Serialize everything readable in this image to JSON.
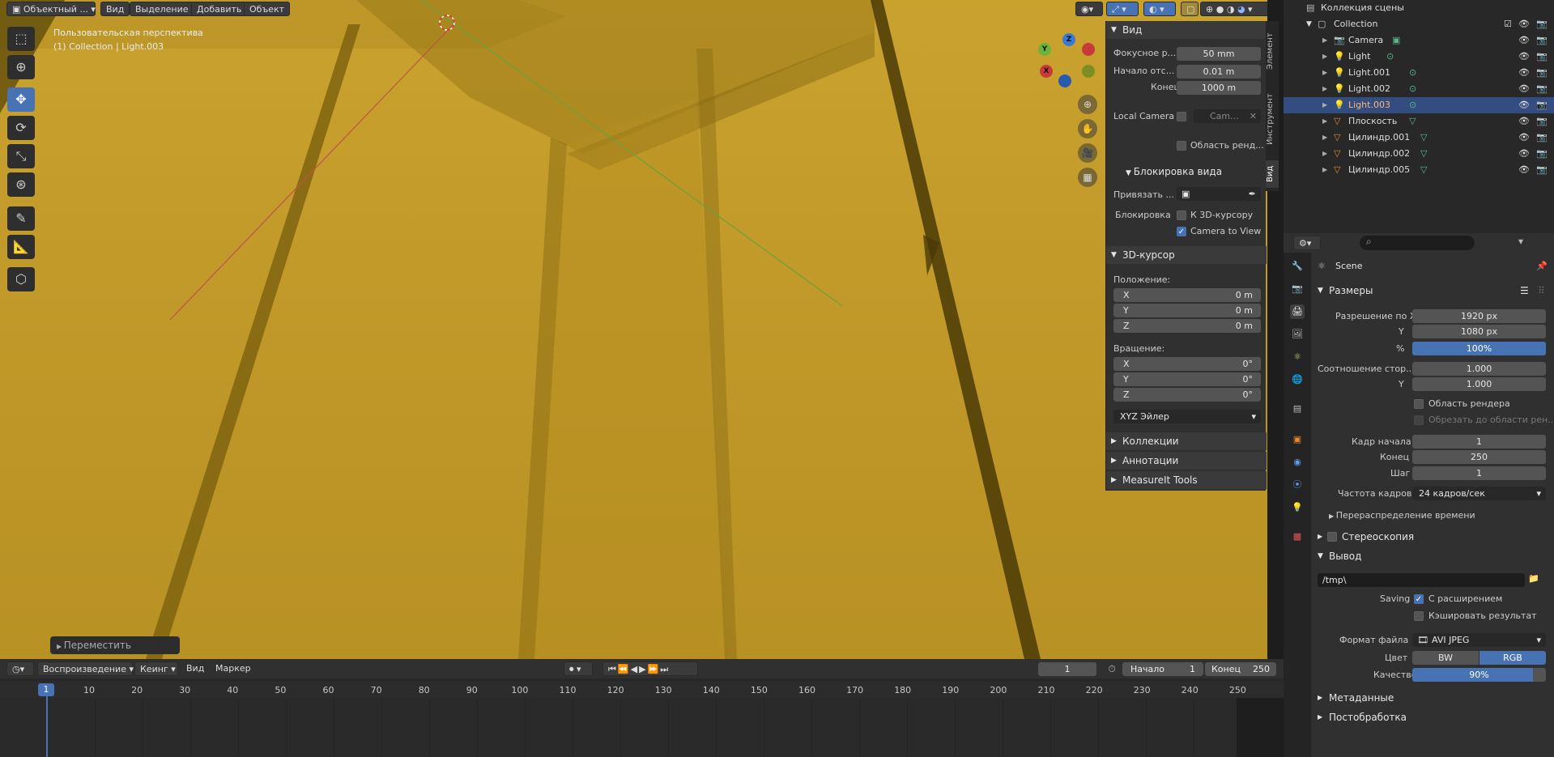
{
  "header": {
    "mode": "Объектный ...",
    "menu": [
      "Вид",
      "Выделение",
      "Добавить",
      "Объект"
    ]
  },
  "viewport_info": {
    "perspective": "Пользовательская перспектива",
    "collection": "(1) Collection | Light.003"
  },
  "gizmo": {
    "x": "X",
    "y": "Y",
    "z": "Z"
  },
  "npanel": {
    "tabs": [
      "Элемент",
      "Инструмент",
      "Вид"
    ],
    "view": {
      "header": "Вид",
      "focal_label": "Фокусное р...",
      "focal_value": "50 mm",
      "clip_start_label": "Начало отс...",
      "clip_start_value": "0.01 m",
      "clip_end_label": "Конец",
      "clip_end_value": "1000 m",
      "local_camera_label": "Local Camera",
      "camera_field": "Cam...",
      "render_region_label": "Область ренд...",
      "lock_header": "Блокировка вида",
      "lock_to_label": "Привязать ...",
      "lock_label": "Блокировка",
      "lock_cursor_label": "К 3D-курсору",
      "camera_to_view_label": "Camera to View"
    },
    "cursor": {
      "header": "3D-курсор",
      "location_label": "Положение:",
      "loc": [
        {
          "axis": "X",
          "value": "0 m"
        },
        {
          "axis": "Y",
          "value": "0 m"
        },
        {
          "axis": "Z",
          "value": "0 m"
        }
      ],
      "rotation_label": "Вращение:",
      "rot": [
        {
          "axis": "X",
          "value": "0°"
        },
        {
          "axis": "Y",
          "value": "0°"
        },
        {
          "axis": "Z",
          "value": "0°"
        }
      ],
      "rotation_mode": "XYZ Эйлер"
    },
    "collapsed": [
      "Коллекции",
      "Аннотации",
      "MeasureIt Tools"
    ]
  },
  "operator_panel": "Переместить",
  "timeline": {
    "menu": [
      "Воспроизведение",
      "Кеинг",
      "Вид",
      "Маркер"
    ],
    "current_frame": "1",
    "start_label": "Начало",
    "start_value": "1",
    "end_label": "Конец",
    "end_value": "250",
    "ruler_marker": "1",
    "ruler": [
      "10",
      "20",
      "30",
      "40",
      "50",
      "60",
      "70",
      "80",
      "90",
      "100",
      "110",
      "120",
      "130",
      "140",
      "150",
      "160",
      "170",
      "180",
      "190",
      "200",
      "210",
      "220",
      "230",
      "240",
      "250"
    ]
  },
  "outliner": {
    "header": "Коллекция сцены",
    "collection": "Collection",
    "items": [
      {
        "name": "Camera",
        "kind": "camera",
        "selected": false
      },
      {
        "name": "Light",
        "kind": "light",
        "selected": false
      },
      {
        "name": "Light.001",
        "kind": "light",
        "selected": false
      },
      {
        "name": "Light.002",
        "kind": "light",
        "selected": false
      },
      {
        "name": "Light.003",
        "kind": "light",
        "selected": true
      },
      {
        "name": "Плоскость",
        "kind": "mesh",
        "selected": false
      },
      {
        "name": "Цилиндр.001",
        "kind": "mesh",
        "selected": false
      },
      {
        "name": "Цилиндр.002",
        "kind": "mesh",
        "selected": false
      },
      {
        "name": "Цилиндр.005",
        "kind": "mesh",
        "selected": false
      }
    ]
  },
  "properties": {
    "scene_name": "Scene",
    "dimensions_header": "Размеры",
    "res_x_label": "Разрешение по X",
    "res_x": "1920 px",
    "res_y_label": "Y",
    "res_y": "1080 px",
    "res_pct_label": "%",
    "res_pct": "100%",
    "res_pct_fraction": 1.0,
    "aspect_label": "Соотношение стор...",
    "aspect_x": "1.000",
    "aspect_y_label": "Y",
    "aspect_y": "1.000",
    "render_region": "Область рендера",
    "crop_region": "Обрезать до области рен...",
    "frame_start_label": "Кадр начала",
    "frame_start": "1",
    "frame_end_label": "Конец",
    "frame_end": "250",
    "frame_step_label": "Шаг",
    "frame_step": "1",
    "fps_label": "Частота кадров",
    "fps": "24 кадров/сек",
    "time_remap": "Перераспределение времени",
    "stereo_header": "Стереоскопия",
    "output_header": "Вывод",
    "output_path": "/tmp\\",
    "saving_label": "Saving",
    "file_ext": "С расширением",
    "cache_result": "Кэшировать результат",
    "file_format_label": "Формат файла",
    "file_format": "AVI JPEG",
    "color_label": "Цвет",
    "color_bw": "BW",
    "color_rgb": "RGB",
    "quality_label": "Качество",
    "quality": "90%",
    "quality_fraction": 0.9,
    "metadata_header": "Метаданные",
    "postprocessing_header": "Постобработка"
  },
  "colors": {
    "accent": "#4772b3",
    "viewport": "#c29a2a",
    "selected_row": "#334d80"
  }
}
